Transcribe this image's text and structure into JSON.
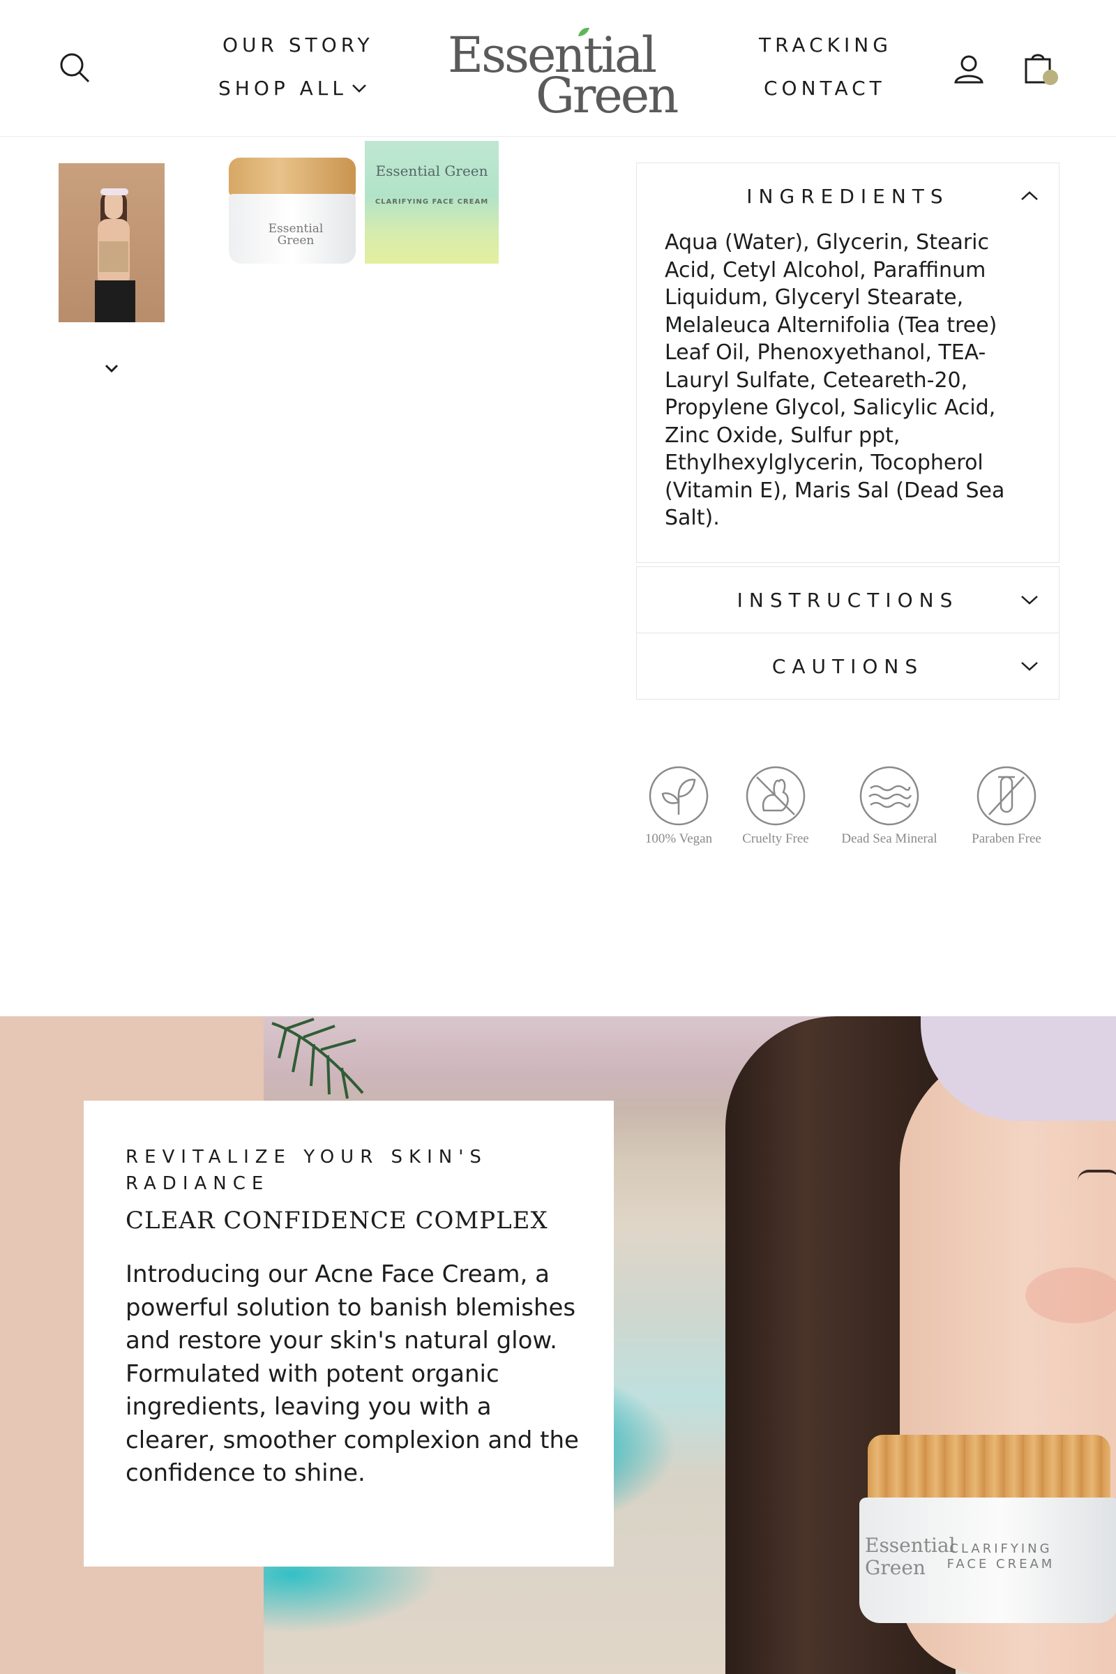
{
  "header": {
    "nav_left": [
      "OUR STORY",
      "SHOP ALL"
    ],
    "nav_right": [
      "TRACKING",
      "CONTACT"
    ],
    "logo_line1": "Essential",
    "logo_line2": "Green",
    "icons": [
      "search-icon",
      "user-icon",
      "cart-icon",
      "chevron-down-icon"
    ],
    "accent_color": "#b9b27f"
  },
  "gallery": {
    "jar_label": "Essential Green",
    "box_logo": "Essential Green",
    "box_title": "CLARIFYING FACE CREAM"
  },
  "accordion": {
    "ingredients_title": "INGREDIENTS",
    "ingredients_text": "Aqua (Water), Glycerin, Stearic Acid, Cetyl Alcohol, Paraffinum Liquidum, Glyceryl Stearate, Melaleuca Alternifolia (Tea tree) Leaf Oil, Phenoxyethanol, TEA-Lauryl Sulfate, Ceteareth-20, Propylene Glycol, Salicylic Acid, Zinc Oxide, Sulfur ppt, Ethylhexylglycerin, Tocopherol (Vitamin E), Maris Sal (Dead Sea Salt).",
    "instructions_title": "INSTRUCTIONS",
    "cautions_title": "CAUTIONS"
  },
  "badges": [
    "100% Vegan",
    "Cruelty Free",
    "Dead Sea Mineral",
    "Paraben Free"
  ],
  "hero": {
    "kicker": "REVITALIZE YOUR SKIN'S RADIANCE",
    "title": "CLEAR CONFIDENCE COMPLEX",
    "body": "Introducing our Acne Face Cream, a powerful solution to banish blemishes and restore your skin's natural glow. Formulated with potent organic ingredients, leaving you with a clearer, smoother complexion and the confidence to shine.",
    "jar_text": "CLARIFYING FACE CREAM",
    "jar_logo": "Essential Green"
  }
}
